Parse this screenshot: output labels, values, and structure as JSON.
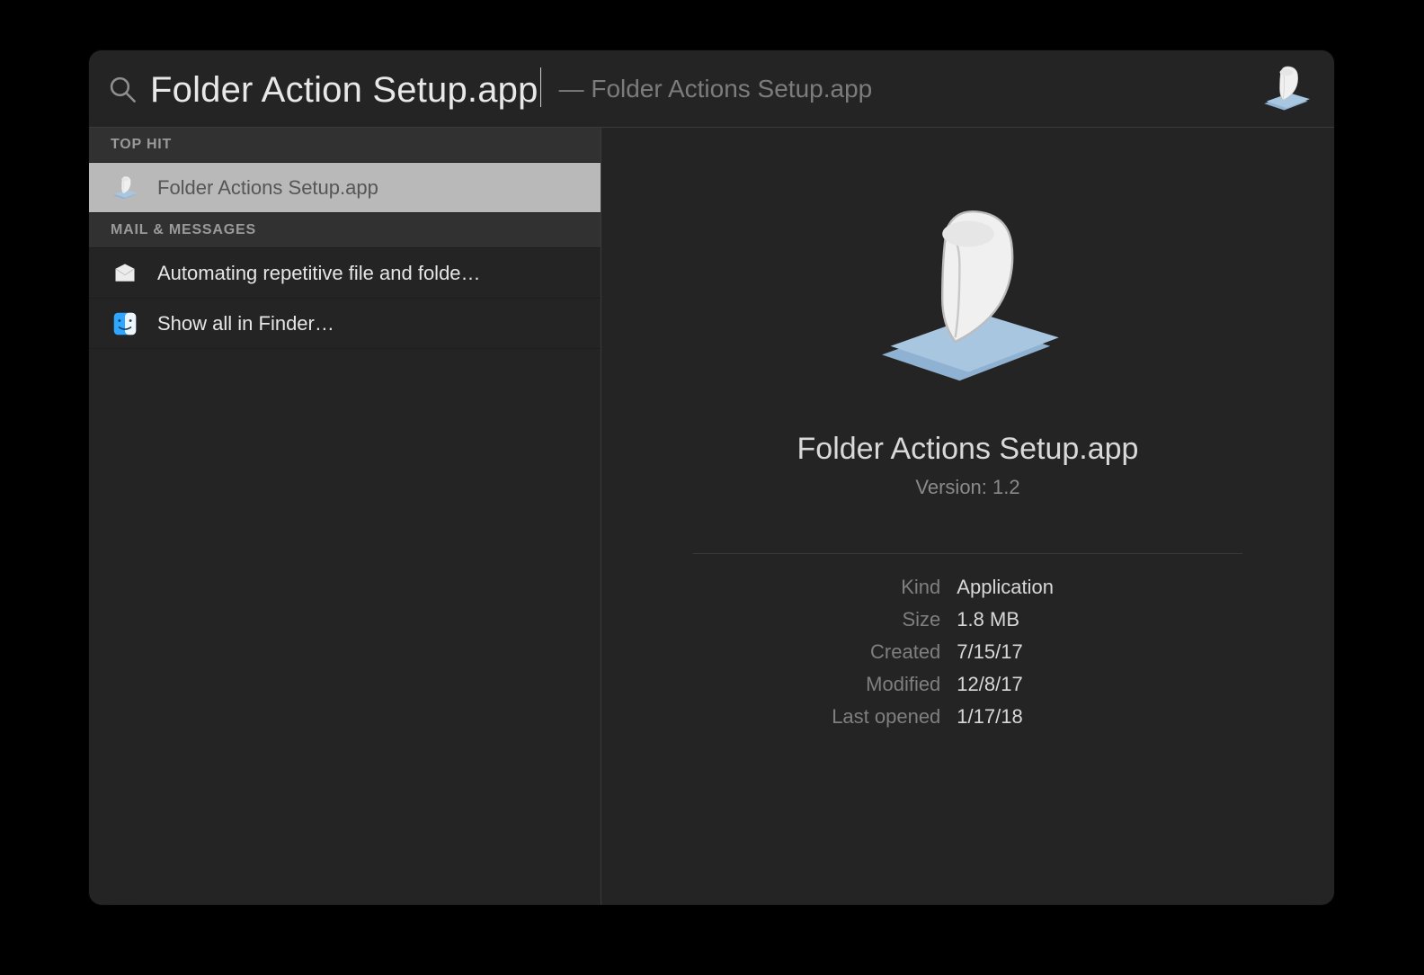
{
  "search": {
    "query": "Folder Action Setup.app",
    "completion": "— Folder Actions Setup.app"
  },
  "sections": {
    "top_hit": {
      "header": "TOP HIT",
      "items": [
        {
          "label": "Folder Actions Setup.app",
          "icon": "script-app",
          "selected": true
        }
      ]
    },
    "mail_messages": {
      "header": "MAIL & MESSAGES",
      "items": [
        {
          "label": "Automating repetitive file and folde…",
          "icon": "mail"
        }
      ]
    }
  },
  "finder_row": {
    "label": "Show all in Finder…"
  },
  "preview": {
    "title": "Folder Actions Setup.app",
    "version": "Version: 1.2",
    "meta": {
      "kind_label": "Kind",
      "kind": "Application",
      "size_label": "Size",
      "size": "1.8 MB",
      "created_label": "Created",
      "created": "7/15/17",
      "modified_label": "Modified",
      "modified": "12/8/17",
      "last_opened_label": "Last opened",
      "last_opened": "1/17/18"
    }
  }
}
